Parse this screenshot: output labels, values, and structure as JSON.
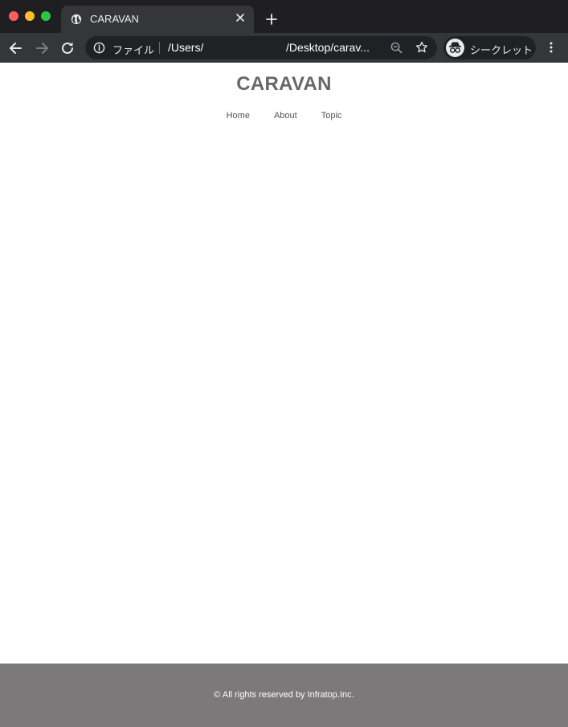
{
  "browser": {
    "tab_title": "CARAVAN",
    "address_scheme": "ファイル",
    "url_part1": "/Users/",
    "url_part2": "/Desktop/carav...",
    "incognito_label": "シークレット",
    "icons": {
      "globe": "globe-icon",
      "close": "close-icon",
      "new_tab": "plus-icon",
      "back": "arrow-left-icon",
      "forward": "arrow-right-icon",
      "reload": "reload-icon",
      "info": "info-icon",
      "zoom": "zoom-out-icon",
      "bookmark": "star-icon",
      "incognito": "incognito-icon",
      "menu": "more-vertical-icon"
    },
    "colors": {
      "titlebar": "#1f1f22",
      "toolbar": "#35363a",
      "omnibox": "#202124",
      "traffic_red": "#fe5f57",
      "traffic_yellow": "#febc2e",
      "traffic_green": "#28c840"
    }
  },
  "site": {
    "title": "CARAVAN",
    "nav": [
      {
        "label": "Home"
      },
      {
        "label": "About"
      },
      {
        "label": "Topic"
      }
    ],
    "footer_text": "© All rights reserved by Infratop.Inc.",
    "colors": {
      "title": "#676767",
      "footer_bg": "#7b797a"
    }
  }
}
